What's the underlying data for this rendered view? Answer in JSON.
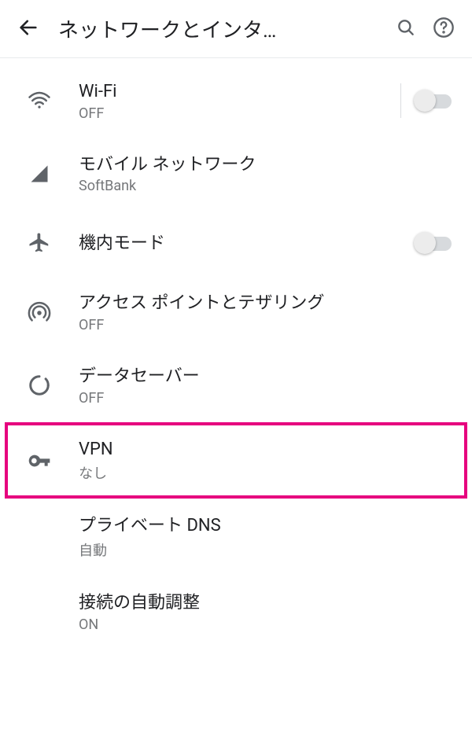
{
  "header": {
    "title": "ネットワークとインタ…"
  },
  "rows": {
    "wifi": {
      "title": "Wi-Fi",
      "sub": "OFF"
    },
    "mobile": {
      "title": "モバイル ネットワーク",
      "sub": "SoftBank"
    },
    "airplane": {
      "title": "機内モード",
      "sub": ""
    },
    "hotspot": {
      "title": "アクセス ポイントとテザリング",
      "sub": "OFF"
    },
    "datasaver": {
      "title": "データセーバー",
      "sub": "OFF"
    },
    "vpn": {
      "title": "VPN",
      "sub": "なし"
    },
    "pdns": {
      "title": "プライベート DNS",
      "sub": "自動"
    },
    "adaptive": {
      "title": "接続の自動調整",
      "sub": "ON"
    }
  }
}
